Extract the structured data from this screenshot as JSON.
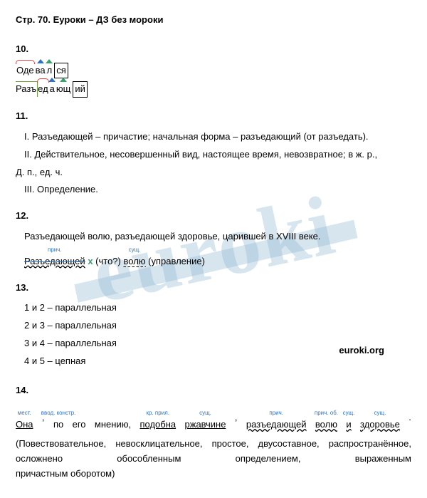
{
  "header": "Стр. 70. Еуроки – ДЗ без мороки",
  "section10": {
    "num": "10.",
    "word1": {
      "root": "Оде",
      "suf1": "ва",
      "suf2": "л",
      "ending": "ся"
    },
    "word2": {
      "prefix": "Разъ",
      "root": "ед",
      "suf1": "а",
      "suf2": "ющ",
      "ending": "ий"
    }
  },
  "section11": {
    "num": "11.",
    "l1": "I. Разъедающей – причастие; начальная форма – разъедающий (от разъедать).",
    "l2": "II. Действительное, несовершенный вид, настоящее время, невозвратное; в ж. р.,",
    "l3": "Д. п., ед. ч.",
    "l4": "III. Определение."
  },
  "section12": {
    "num": "12.",
    "l1": "Разъедающей волю, разъедающей здоровье, царившей в XVIII веке.",
    "lab1": "прич.",
    "lab2": "сущ.",
    "w1": "Разъедающей",
    "q": " (что?) ",
    "w2": "волю",
    "tail": " (управление)",
    "x": "х"
  },
  "section13": {
    "num": "13.",
    "r1": "1 и 2 – параллельная",
    "r2": "2 и 3 – параллельная",
    "r3": "3 и 4 – параллельная",
    "r4": "4 и 5 – цепная"
  },
  "brand": "euroki.org",
  "watermark": "euroki",
  "section14": {
    "num": "14.",
    "labs": {
      "mest": "мест.",
      "vvod": "ввод. констр.",
      "krpril": "кр. прил.",
      "sush": "сущ.",
      "prich": "прич.",
      "prichob": "прич. об.",
      "soyuz": "и"
    },
    "w": {
      "ona": "Она",
      "comma1": ",",
      "po": "по",
      "ego": "его",
      "mneniyu": "мнению,",
      "podobna": "подобна",
      "rzhav": "ржавчине",
      "comma2": ",",
      "razed": "разъедающей",
      "volyu": "волю",
      "i": "и",
      "zdor": "здоровье",
      "dot": "."
    },
    "paren": {
      "p1": "(Повествовательное,",
      "p2": "невосклицательное,",
      "p3": "простое,",
      "p4": "двусоставное,",
      "p5": "распространённое,",
      "p6": "осложнено",
      "p7": "обособленным",
      "p8": "определением,",
      "p9": "выраженным",
      "p10": "причастным оборотом)"
    }
  }
}
